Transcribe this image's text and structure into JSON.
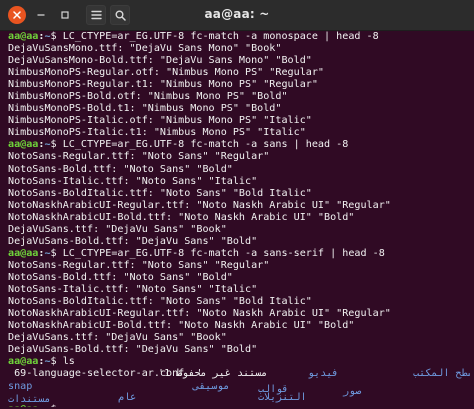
{
  "window": {
    "title": "aa@aa: ~",
    "menu_icon": "hamburger-menu-icon",
    "search_icon": "search-icon"
  },
  "prompt": {
    "user_host": "aa@aa",
    "separator": ":",
    "path": "~",
    "sign": "$"
  },
  "blocks": [
    {
      "command": " LC_CTYPE=ar_EG.UTF-8 fc-match -a monospace | head -8",
      "output": [
        "DejaVuSansMono.ttf: \"DejaVu Sans Mono\" \"Book\"",
        "DejaVuSansMono-Bold.ttf: \"DejaVu Sans Mono\" \"Bold\"",
        "NimbusMonoPS-Regular.otf: \"Nimbus Mono PS\" \"Regular\"",
        "NimbusMonoPS-Regular.t1: \"Nimbus Mono PS\" \"Regular\"",
        "NimbusMonoPS-Bold.otf: \"Nimbus Mono PS\" \"Bold\"",
        "NimbusMonoPS-Bold.t1: \"Nimbus Mono PS\" \"Bold\"",
        "NimbusMonoPS-Italic.otf: \"Nimbus Mono PS\" \"Italic\"",
        "NimbusMonoPS-Italic.t1: \"Nimbus Mono PS\" \"Italic\""
      ]
    },
    {
      "command": " LC_CTYPE=ar_EG.UTF-8 fc-match -a sans | head -8",
      "output": [
        "NotoSans-Regular.ttf: \"Noto Sans\" \"Regular\"",
        "NotoSans-Bold.ttf: \"Noto Sans\" \"Bold\"",
        "NotoSans-Italic.ttf: \"Noto Sans\" \"Italic\"",
        "NotoSans-BoldItalic.ttf: \"Noto Sans\" \"Bold Italic\"",
        "NotoNaskhArabicUI-Regular.ttf: \"Noto Naskh Arabic UI\" \"Regular\"",
        "NotoNaskhArabicUI-Bold.ttf: \"Noto Naskh Arabic UI\" \"Bold\"",
        "DejaVuSans.ttf: \"DejaVu Sans\" \"Book\"",
        "DejaVuSans-Bold.ttf: \"DejaVu Sans\" \"Bold\""
      ]
    },
    {
      "command": " LC_CTYPE=ar_EG.UTF-8 fc-match -a sans-serif | head -8",
      "output": [
        "NotoSans-Regular.ttf: \"Noto Sans\" \"Regular\"",
        "NotoSans-Bold.ttf: \"Noto Sans\" \"Bold\"",
        "NotoSans-Italic.ttf: \"Noto Sans\" \"Italic\"",
        "NotoSans-BoldItalic.ttf: \"Noto Sans\" \"Bold Italic\"",
        "NotoNaskhArabicUI-Regular.ttf: \"Noto Naskh Arabic UI\" \"Regular\"",
        "NotoNaskhArabicUI-Bold.ttf: \"Noto Naskh Arabic UI\" \"Bold\"",
        "DejaVuSans.ttf: \"DejaVu Sans\" \"Book\"",
        "DejaVuSans-Bold.ttf: \"DejaVu Sans\" \"Bold\""
      ]
    },
    {
      "command": " ls",
      "output": []
    }
  ],
  "ls": {
    "file": " 69-language-selector-ar.conf  '",
    "quoted_dir": "مستند غير محفوظ 1'",
    "dirs": [
      "سطح المكتب",
      "فيديو",
      "صور",
      "قوالب",
      "موسيقى",
      "snap",
      "مستندات",
      "عام",
      "التنزيلات"
    ]
  },
  "colors": {
    "background": "#300a24",
    "titlebar": "#2c2c2c",
    "prompt_user": "#6fd33a",
    "prompt_path": "#729fcf",
    "text": "#f2f2f2",
    "directory": "#6f9be0",
    "close_button": "#e95420"
  }
}
